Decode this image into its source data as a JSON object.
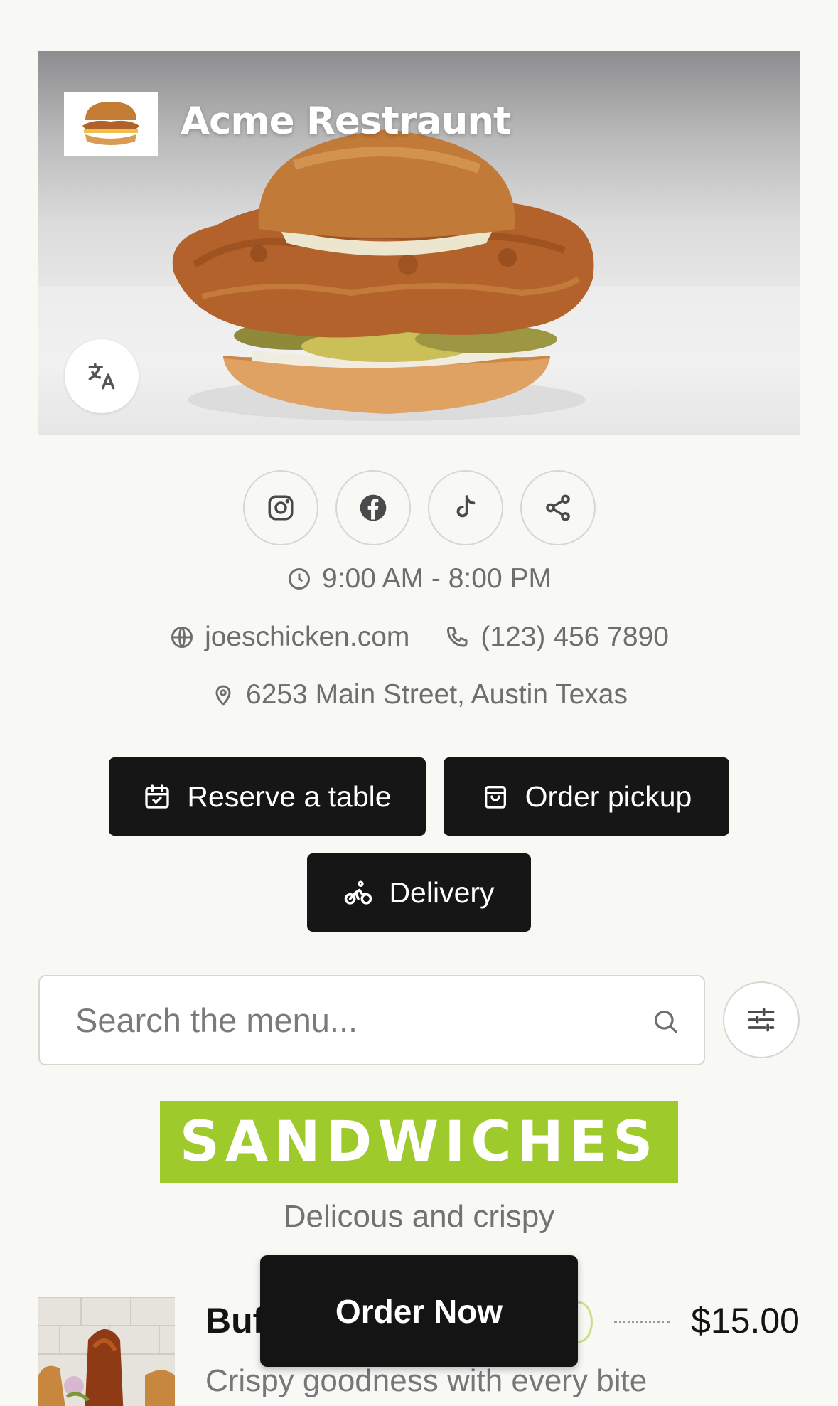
{
  "restaurant": {
    "name": "Acme Restraunt"
  },
  "social": {
    "items": [
      {
        "icon": "instagram-icon"
      },
      {
        "icon": "facebook-icon"
      },
      {
        "icon": "tiktok-icon"
      },
      {
        "icon": "share-icon"
      }
    ]
  },
  "info": {
    "hours": "9:00 AM - 8:00 PM",
    "website": "joeschicken.com",
    "phone": "(123) 456 7890",
    "address": "6253 Main Street, Austin Texas"
  },
  "actions": {
    "reserve_label": "Reserve a table",
    "pickup_label": "Order pickup",
    "delivery_label": "Delivery"
  },
  "search": {
    "placeholder": "Search the menu..."
  },
  "section": {
    "title": "SANDWICHES",
    "subtitle": "Delicous and crispy",
    "accent_color": "#9ecb2b"
  },
  "menu_items": [
    {
      "name": "Buf",
      "price": "$15.00",
      "description": "Crispy goodness with every bite"
    }
  ],
  "floating_button": {
    "label": "Order Now"
  }
}
